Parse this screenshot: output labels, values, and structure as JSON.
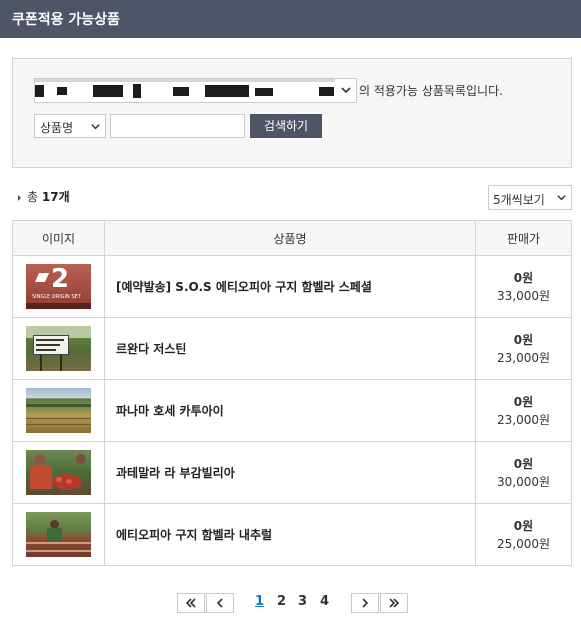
{
  "header": {
    "title": "쿠폰적용 가능상품"
  },
  "search": {
    "select_suffix": "의 적용가능 상품목록입니다.",
    "field_selected": "상품명",
    "input_value": "",
    "input_placeholder": "",
    "search_button": "검색하기"
  },
  "summary": {
    "total_prefix": "총",
    "total_count": "17개",
    "per_page": "5개씩보기"
  },
  "table": {
    "columns": [
      "이미지",
      "상품명",
      "판매가"
    ],
    "rows": [
      {
        "name": "[예약발송] S.O.S 에티오피아 구지 함벨라 스페셜",
        "sale_price": "0원",
        "original_price": "33,000원",
        "thumb": "single-origin-set-image",
        "thumb_text": "SINGLE ORIGIN SET"
      },
      {
        "name": "르완다 저스틴",
        "sale_price": "0원",
        "original_price": "23,000원",
        "thumb": "farm-signboard-image"
      },
      {
        "name": "파나마 호세 카투아이",
        "sale_price": "0원",
        "original_price": "23,000원",
        "thumb": "coffee-field-image"
      },
      {
        "name": "과테말라 라 부감빌리아",
        "sale_price": "0원",
        "original_price": "30,000원",
        "thumb": "farmer-coffee-cherries-image"
      },
      {
        "name": "에티오피아 구지 함벨라 내추럴",
        "sale_price": "0원",
        "original_price": "25,000원",
        "thumb": "drying-beds-image"
      }
    ]
  },
  "pagination": {
    "first": "«",
    "prev": "‹",
    "pages": [
      "1",
      "2",
      "3",
      "4"
    ],
    "current": "1",
    "next": "›",
    "last": "»"
  },
  "colors": {
    "header_bg": "#4d5566",
    "button_bg": "#4d5566",
    "active_page": "#1a73b8",
    "border": "#d4d4d4"
  }
}
